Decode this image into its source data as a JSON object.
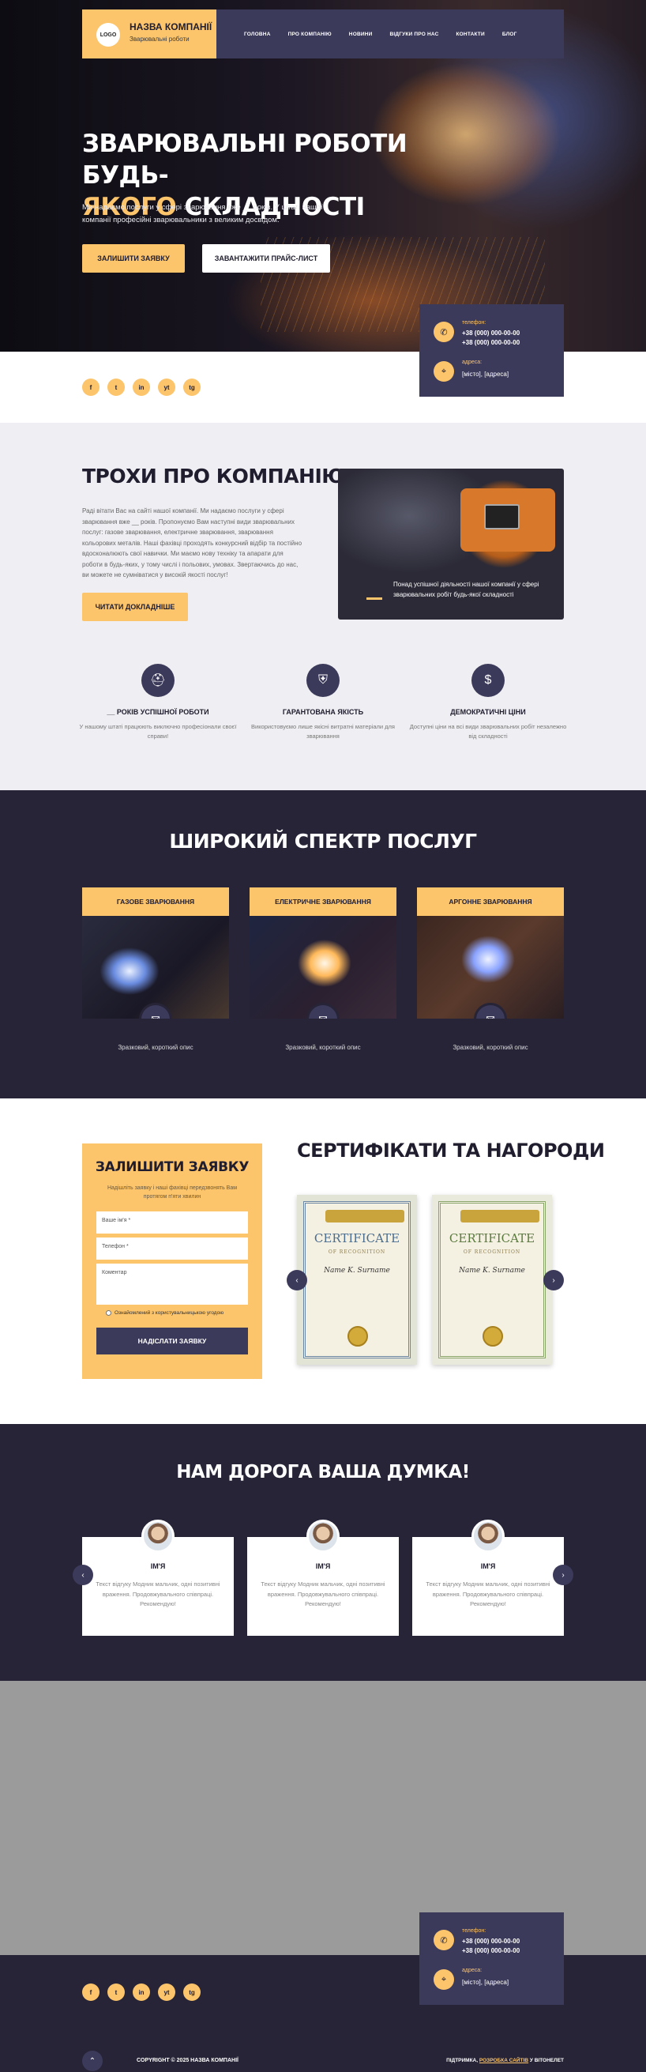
{
  "header": {
    "logo_text": "LOGO",
    "company_name": "НАЗВА КОМПАНІЇ",
    "company_sub": "Зварювальні роботи",
    "nav": [
      "ГОЛОВНА",
      "ПРО КОМПАНІЮ",
      "НОВИНИ",
      "ВІДГУКИ ПРО НАС",
      "КОНТАКТИ",
      "БЛОГ"
    ]
  },
  "hero": {
    "title_line1": "ЗВАРЮВАЛЬНІ РОБОТИ БУДЬ-",
    "title_accent": "ЯКОГО",
    "title_line2_rest": " СКЛАДНОСТІ",
    "text": "Ми надаємо послуги у сфері зварювання вже __ років. У штаті нашої компанії професійні зварювальники з великим досвідом.",
    "btn_primary": "ЗАЛИШИТИ ЗАЯВКУ",
    "btn_secondary": "ЗАВАНТАЖИТИ ПРАЙС-ЛИСТ"
  },
  "contact": {
    "phone_label": "телефон:",
    "phone1": "+38 (000) 000-00-00",
    "phone2": "+38 (000) 000-00-00",
    "address_label": "адреса:",
    "address": "[місто], [адреса]"
  },
  "socials": [
    "f",
    "t",
    "in",
    "yt",
    "tg"
  ],
  "about": {
    "title": "ТРОХИ ПРО КОМПАНІЮ",
    "text": "Раді вітати Вас на сайті нашої компанії. Ми надаємо послуги у сфері зварювання вже __ років. Пропонуємо Вам наступні види зварювальних послуг: газове зварювання, електричне зварювання, зварювання кольорових металів. Наші фахівці проходять конкурсний відбір та постійно вдосконалюють свої навички. Ми маємо нову техніку та апарати для роботи в будь-яких, у тому числі і польових, умовах. Звертаючись до нас, ви можете не сумніватися у високій якості послуг!",
    "button": "ЧИТАТИ ДОКЛАДНІШЕ",
    "image_caption": "Понад успішної діяльності нашої компанії у сфері зварювальних робіт будь-якої складності"
  },
  "features": [
    {
      "icon": "mask-icon",
      "title": "__ РОКІВ УСПІШНОЇ РОБОТИ",
      "text": "У нашому штаті працюють виключно професіонали своєї справи!"
    },
    {
      "icon": "shield-icon",
      "title": "ГАРАНТОВАНА ЯКІСТЬ",
      "text": "Використовуємо лише якісні витратні матеріали для зварювання"
    },
    {
      "icon": "coins-icon",
      "title": "ДЕМОКРАТИЧНІ ЦІНИ",
      "text": "Доступні ціни на всі види зварювальних робіт незалежно від складності"
    }
  ],
  "services": {
    "title": "ШИРОКИЙ СПЕКТР ПОСЛУГ",
    "items": [
      {
        "title": "ГАЗОВЕ ЗВАРЮВАННЯ",
        "desc": "Зразковий, короткий опис"
      },
      {
        "title": "ЕЛЕКТРИЧНЕ ЗВАРЮВАННЯ",
        "desc": "Зразковий, короткий опис"
      },
      {
        "title": "АРГОННЕ ЗВАРЮВАННЯ",
        "desc": "Зразковий, короткий опис"
      }
    ]
  },
  "form": {
    "title": "ЗАЛИШИТИ ЗАЯВКУ",
    "subtitle": "Надішліть заявку і наші фахівці передзвонять Вам протягом п'яти хвилин",
    "name_placeholder": "Ваше ім'я *",
    "phone_placeholder": "Телефон *",
    "comment_placeholder": "Коментар",
    "agree": "Ознайомлений з користувальницькою угодою",
    "submit": "НАДІСЛАТИ ЗАЯВКУ"
  },
  "certificates": {
    "title": "СЕРТИФІКАТИ ТА НАГОРОДИ",
    "items": [
      {
        "word": "CERTIFICATE",
        "of": "OF RECOGNITION",
        "name": "Name K. Surname"
      },
      {
        "word": "CERTIFICATE",
        "of": "OF RECOGNITION",
        "name": "Name K. Surname"
      }
    ]
  },
  "reviews": {
    "title": "НАМ ДОРОГА ВАША ДУМКА!",
    "items": [
      {
        "name": "ІМ'Я",
        "text": "Текст відгуку Модник мальчик, одні позитивні враження. Продовжувального співпраці. Рекомендую!"
      },
      {
        "name": "ІМ'Я",
        "text": "Текст відгуку Модник мальчик, одні позитивні враження. Продовжувального співпраці. Рекомендую!"
      },
      {
        "name": "ІМ'Я",
        "text": "Текст відгуку Модник мальчик, одні позитивні враження. Продовжувального співпраці. Рекомендую!"
      }
    ]
  },
  "footer": {
    "copyright": "COPYRIGHT © 2025 НАЗВА КОМПАНІЇ",
    "dev_prefix": "ПІДТРИМКА, ",
    "dev_link": "РОЗРОБКА САЙТІВ",
    "dev_suffix": " У ВІТОНЕЛЕТ"
  },
  "colors": {
    "accent": "#fcc46b",
    "dark": "#262436",
    "panel": "#3c3a5a"
  }
}
